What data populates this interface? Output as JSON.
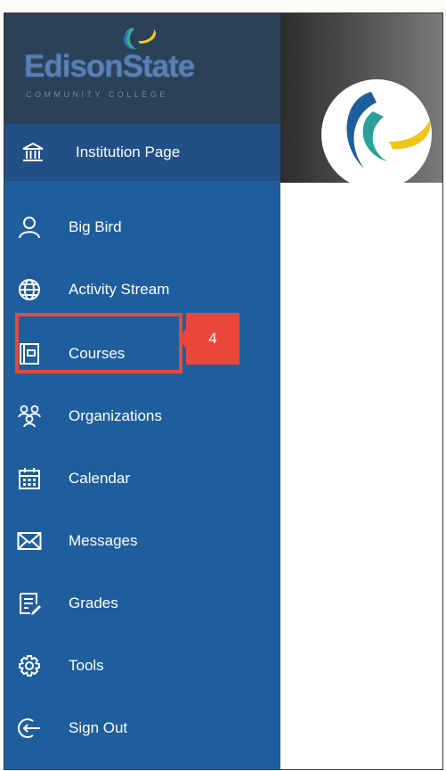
{
  "brand": {
    "name": "EdisonState",
    "subtitle": "COMMUNITY COLLEGE"
  },
  "nav": {
    "items": [
      {
        "label": "Institution Page",
        "icon": "institution-icon"
      },
      {
        "label": "Big Bird",
        "icon": "user-icon"
      },
      {
        "label": "Activity Stream",
        "icon": "globe-icon"
      },
      {
        "label": "Courses",
        "icon": "courses-icon"
      },
      {
        "label": "Organizations",
        "icon": "organizations-icon"
      },
      {
        "label": "Calendar",
        "icon": "calendar-icon"
      },
      {
        "label": "Messages",
        "icon": "envelope-icon"
      },
      {
        "label": "Grades",
        "icon": "grades-icon"
      },
      {
        "label": "Tools",
        "icon": "gear-icon"
      },
      {
        "label": "Sign Out",
        "icon": "sign-out-icon"
      }
    ],
    "active": "Institution Page"
  },
  "annotation": {
    "callout_number": "4"
  },
  "colors": {
    "sidebar": "#1f5e9c",
    "brand_bg": "#2a4158",
    "highlight": "#e24a3b",
    "logo_blue": "#1f5e9c",
    "logo_yellow": "#f0c419",
    "logo_teal": "#2aa198"
  }
}
